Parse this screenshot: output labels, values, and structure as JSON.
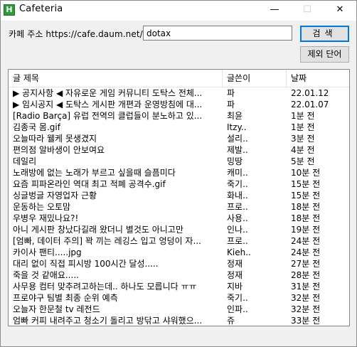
{
  "window": {
    "title": "Cafeteria",
    "icon_letter": "H",
    "controls": {
      "minimize": "—",
      "maximize": "☐",
      "close": "✕"
    }
  },
  "search": {
    "url_label": "카페 주소 https://cafe.daum.net/",
    "cafe_id_value": "dotax",
    "search_button": "검색",
    "exclude_words_button": "제외 단어"
  },
  "list": {
    "columns": {
      "title": "글 제목",
      "writer": "글쓴이",
      "date": "날짜"
    },
    "rows": [
      {
        "title": "▶ 공지사항 ◀ 자유로운 게임 커뮤니티 도탁스 전체...",
        "writer": "파",
        "date": "22.01.12"
      },
      {
        "title": "▶ 임시공지 ◀ 도탁스 게시판 개편과 운영방침에 대...",
        "writer": "파",
        "date": "22.01.07"
      },
      {
        "title": "[Radio Barça] 유럽 전역의 클럽들이 분노하고 있...",
        "writer": "최윤",
        "date": "1분 전"
      },
      {
        "title": "김종국 몸.gif",
        "writer": "Itzy..",
        "date": "1분 전"
      },
      {
        "title": "오늘따라 웰케 못생겼지",
        "writer": "설리..",
        "date": "3분 전"
      },
      {
        "title": "편의점 알바생이 안보여요",
        "writer": "제발..",
        "date": "4분 전"
      },
      {
        "title": "데일리",
        "writer": "밍땅",
        "date": "5분 전"
      },
      {
        "title": "노래방에 없는 노래가 부르고 싶을때 슬픔미다",
        "writer": "캐미..",
        "date": "10분 전"
      },
      {
        "title": "요즘 피파온라인 역대 최고 적폐 공격수.gif",
        "writer": "죽기..",
        "date": "15분 전"
      },
      {
        "title": "싱글벙글 자영업자 근황",
        "writer": "화내..",
        "date": "15분 전"
      },
      {
        "title": "운동하는 오토맘",
        "writer": "프로..",
        "date": "18분 전"
      },
      {
        "title": "우병우 재밌나요?!",
        "writer": "사용..",
        "date": "18분 전"
      },
      {
        "title": "아니 게시판 창났다길래 왔더니 별것도 아니고만",
        "writer": "인나..",
        "date": "19분 전"
      },
      {
        "title": "[엄빠, 데이터 주의] 꽉 끼는 레깅스 입고 엉덩이 자...",
        "writer": "프로..",
        "date": "24분 전"
      },
      {
        "title": "카이사 팬티.....jpg",
        "writer": "Kieh..",
        "date": "24분 전"
      },
      {
        "title": "대리 없이 직접 피시방 100시간 달성.....",
        "writer": "정재",
        "date": "27분 전"
      },
      {
        "title": "죽을 것 같애요.....",
        "writer": "정재",
        "date": "28분 전"
      },
      {
        "title": "사무용 컴터 맞추려고하는데.. 하나도 모릅니다 ㅠㅠ",
        "writer": "지바",
        "date": "31분 전"
      },
      {
        "title": "프로야구 팀별 최종 순위 예측",
        "writer": "죽기..",
        "date": "32분 전"
      },
      {
        "title": "오늘자 한문철 tv 레전드",
        "writer": "인파..",
        "date": "32분 전"
      },
      {
        "title": "엄빠 커피 내려주고 청소기 돌리고 방닦고 샤워했으...",
        "writer": "쥬",
        "date": "33분 전"
      }
    ]
  }
}
